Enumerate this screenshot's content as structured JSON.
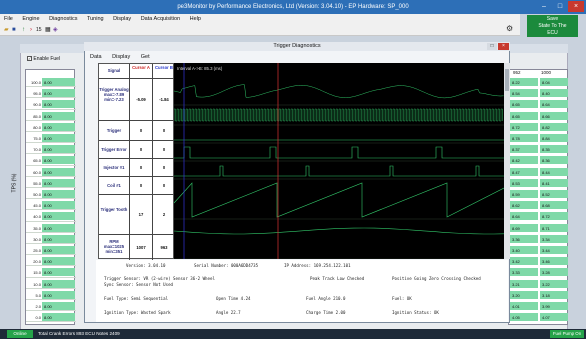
{
  "app": {
    "title": "pe3Monitor by Performance Electronics, Ltd  (Version: 3.04.10)  -  EP Hardware: SP_000"
  },
  "menu": [
    "File",
    "Engine",
    "Diagnostics",
    "Tuning",
    "Display",
    "Data Acquisition",
    "Help"
  ],
  "toolbar": {
    "number": "15"
  },
  "save": {
    "line1": "Save",
    "line2": "State To The",
    "line3": "ECU"
  },
  "bg": {
    "enable_fuel": "Enable Fuel",
    "col0": "0",
    "rcol1": "952",
    "rcol2": "1000",
    "axis_label": "TPS (%)"
  },
  "left_rows": [
    {
      "y": "100.0",
      "v": "8.00"
    },
    {
      "y": "95.0",
      "v": "8.00"
    },
    {
      "y": "90.0",
      "v": "8.00"
    },
    {
      "y": "85.0",
      "v": "8.00"
    },
    {
      "y": "80.0",
      "v": "8.00"
    },
    {
      "y": "75.0",
      "v": "8.00"
    },
    {
      "y": "70.0",
      "v": "8.00"
    },
    {
      "y": "65.0",
      "v": "8.00"
    },
    {
      "y": "60.0",
      "v": "8.00"
    },
    {
      "y": "55.0",
      "v": "8.00"
    },
    {
      "y": "50.0",
      "v": "8.00"
    },
    {
      "y": "45.0",
      "v": "8.00"
    },
    {
      "y": "40.0",
      "v": "8.00"
    },
    {
      "y": "35.0",
      "v": "8.00"
    },
    {
      "y": "30.0",
      "v": "8.00"
    },
    {
      "y": "25.0",
      "v": "8.00"
    },
    {
      "y": "20.0",
      "v": "8.00"
    },
    {
      "y": "15.0",
      "v": "8.00"
    },
    {
      "y": "10.0",
      "v": "8.00"
    },
    {
      "y": "5.0",
      "v": "8.00"
    },
    {
      "y": "2.0",
      "v": "8.00"
    },
    {
      "y": "0.0",
      "v": "8.00"
    }
  ],
  "right_rows": [
    {
      "a": "8.22",
      "b": "8.04"
    },
    {
      "a": "8.54",
      "b": "8.40"
    },
    {
      "a": "8.65",
      "b": "8.64"
    },
    {
      "a": "8.65",
      "b": "8.66"
    },
    {
      "a": "8.72",
      "b": "8.82"
    },
    {
      "a": "8.78",
      "b": "8.84"
    },
    {
      "a": "8.37",
      "b": "8.35"
    },
    {
      "a": "8.42",
      "b": "8.36"
    },
    {
      "a": "8.47",
      "b": "8.44"
    },
    {
      "a": "8.53",
      "b": "8.41"
    },
    {
      "a": "8.59",
      "b": "8.52"
    },
    {
      "a": "8.62",
      "b": "8.68"
    },
    {
      "a": "8.64",
      "b": "8.72"
    },
    {
      "a": "8.69",
      "b": "8.71"
    },
    {
      "a": "3.36",
      "b": "3.34"
    },
    {
      "a": "3.40",
      "b": "3.44"
    },
    {
      "a": "3.42",
      "b": "3.46"
    },
    {
      "a": "3.33",
      "b": "3.28"
    },
    {
      "a": "3.21",
      "b": "3.22"
    },
    {
      "a": "3.20",
      "b": "3.18"
    },
    {
      "a": "4.01",
      "b": "3.99"
    },
    {
      "a": "4.05",
      "b": "4.07"
    }
  ],
  "diag": {
    "title": "Trigger Diagnostics",
    "menu": [
      "Data",
      "Display",
      "Get"
    ],
    "hdr_signal": "Signal",
    "hdr_cursor_a": "Cursor A",
    "hdr_cursor_b": "Cursor B",
    "interval": "Interval A->B: 85.3 (ms)",
    "rows": [
      {
        "name": "Trigger Analog max=-7.89 min=-7.23",
        "a": "-5.09",
        "b": "-1.84"
      },
      {
        "name": "Trigger",
        "a": "0",
        "b": "0"
      },
      {
        "name": "Trigger Error",
        "a": "0",
        "b": "0"
      },
      {
        "name": "Injector #1",
        "a": "0",
        "b": "0"
      },
      {
        "name": "Coil #1",
        "a": "0",
        "b": "0"
      },
      {
        "name": "Trigger Tooth",
        "a": "17",
        "b": "2"
      },
      {
        "name": "RPM max=1025 min=351",
        "a": "1007",
        "b": "963"
      }
    ],
    "info": {
      "version": "Version: 3.04.10",
      "serial": "Serial Number: 000A6DD4735",
      "ip": "IP Address: 169.254.122.101",
      "trigger_sensor": "Trigger Sensor: VR (2-wire) Sensor   36-2 Wheel",
      "sync_sensor": "Sync Sensor: Sensor Not Used",
      "peak_track": "Peak Track Low Checked",
      "zero_cross": "Positive Going Zero Crossing Checked",
      "fuel_type": "Fuel Type: Semi Sequential",
      "open_time": "Open Time 4.24",
      "fuel_angle": "Fuel Angle 210.0",
      "fuel": "Fuel: OK",
      "ign_type": "Ignition Type: Wasted Spark",
      "angle": "Angle 22.7",
      "charge": "Charge Time 2.00",
      "ign_status": "Ignition Status: OK"
    }
  },
  "status": {
    "online": "Online",
    "text": "Total Crank Errors 893  ECU Notes 2409",
    "fuel_pump": "Fuel Pump On"
  },
  "colors": {
    "title": "#2d6fb7",
    "cell": "#7fd9a8",
    "trace": "#32c86a",
    "save": "#1b8a3c"
  }
}
